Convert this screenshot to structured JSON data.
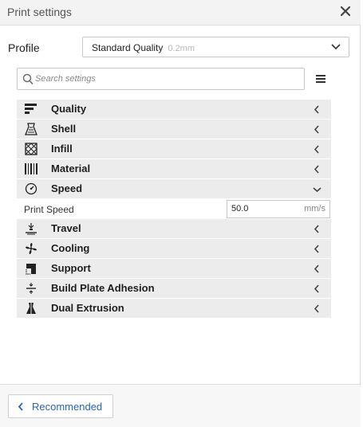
{
  "panel": {
    "title": "Print settings"
  },
  "profile": {
    "label": "Profile",
    "name": "Standard Quality",
    "layer": "0.2mm"
  },
  "search": {
    "placeholder": "Search settings",
    "value": ""
  },
  "categories": [
    {
      "label": "Quality",
      "icon": "quality-icon",
      "expanded": false
    },
    {
      "label": "Shell",
      "icon": "shell-icon",
      "expanded": false
    },
    {
      "label": "Infill",
      "icon": "infill-icon",
      "expanded": false
    },
    {
      "label": "Material",
      "icon": "material-icon",
      "expanded": false
    },
    {
      "label": "Speed",
      "icon": "speed-icon",
      "expanded": true
    },
    {
      "label": "Travel",
      "icon": "travel-icon",
      "expanded": false
    },
    {
      "label": "Cooling",
      "icon": "cooling-icon",
      "expanded": false
    },
    {
      "label": "Support",
      "icon": "support-icon",
      "expanded": false
    },
    {
      "label": "Build Plate Adhesion",
      "icon": "adhesion-icon",
      "expanded": false
    },
    {
      "label": "Dual Extrusion",
      "icon": "dual-extrusion-icon",
      "expanded": false
    }
  ],
  "speed_settings": [
    {
      "label": "Print Speed",
      "value": "50.0",
      "unit": "mm/s"
    }
  ],
  "footer": {
    "recommended_label": "Recommended"
  },
  "colors": {
    "accent": "#2a63b8",
    "category_bg": "#ececec"
  }
}
